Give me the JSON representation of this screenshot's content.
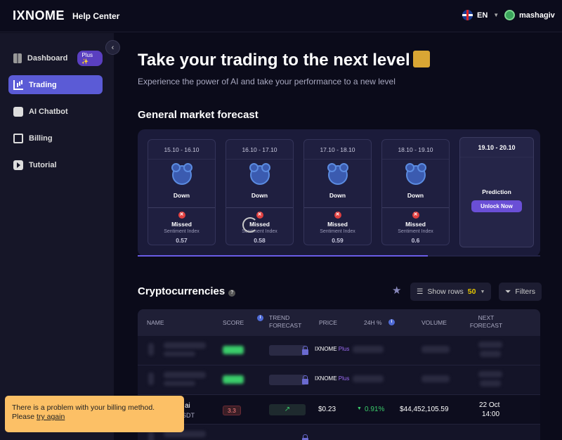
{
  "brand": {
    "logo": "IXNOME",
    "help_center": "Help Center"
  },
  "header": {
    "language": "EN",
    "username": "mashagiv"
  },
  "sidebar": {
    "items": [
      {
        "label": "Dashboard",
        "badge": "Plus ✨"
      },
      {
        "label": "Trading"
      },
      {
        "label": "AI Chatbot"
      },
      {
        "label": "Billing"
      },
      {
        "label": "Tutorial"
      }
    ]
  },
  "hero": {
    "title": "Take your trading to the next level",
    "subtitle": "Experience the power of AI and take your performance to a new level"
  },
  "forecast": {
    "title": "General market forecast",
    "cards": [
      {
        "date": "15.10 - 16.10",
        "direction": "Down",
        "status": "Missed",
        "index_label": "Sentiment Index",
        "value": "0.57"
      },
      {
        "date": "16.10 - 17.10",
        "direction": "Down",
        "status": "Missed",
        "index_label": "Sentiment Index",
        "value": "0.58"
      },
      {
        "date": "17.10 - 18.10",
        "direction": "Down",
        "status": "Missed",
        "index_label": "Sentiment Index",
        "value": "0.59"
      },
      {
        "date": "18.10 - 19.10",
        "direction": "Down",
        "status": "Missed",
        "index_label": "Sentiment Index",
        "value": "0.6"
      }
    ],
    "prediction": {
      "date": "19.10 - 20.10",
      "title": "Prediction",
      "button": "Unlock Now"
    },
    "progress": 0.72
  },
  "crypto": {
    "title": "Cryptocurrencies",
    "show_rows_label": "Show rows",
    "show_rows_value": "50",
    "filters_label": "Filters",
    "columns": [
      "NAME",
      "SCORE",
      "TREND FORECAST",
      "PRICE",
      "24H %",
      "VOLUME",
      "NEXT FORECAST"
    ],
    "locked_label_brand": "IXNOME",
    "locked_label_plus": "Plus",
    "row3": {
      "name_fragment": "ai",
      "pair_fragment": "SDT",
      "score": "3.3",
      "price": "$0.23",
      "change": "0.91%",
      "volume": "$44,452,105.59",
      "next_date": "22 Oct",
      "next_time": "14:00"
    }
  },
  "toast": {
    "message": "There is a problem with your billing method.",
    "prefix": "Please",
    "link": "try again"
  },
  "colors": {
    "accent": "#5b5bd6",
    "plus": "#9b6bf2",
    "toast": "#fcc066",
    "positive": "#3acc6a"
  }
}
